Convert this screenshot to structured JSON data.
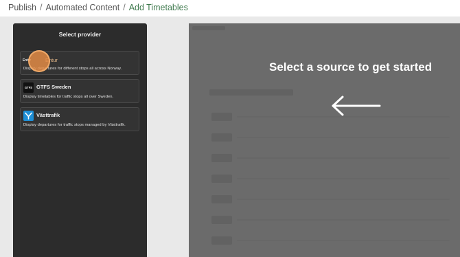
{
  "breadcrumb": {
    "items": [
      "Publish",
      "Automated Content"
    ],
    "separator": "/",
    "current": "Add Timetables"
  },
  "provider_panel": {
    "title": "Select provider",
    "providers": [
      {
        "name": "Entur",
        "logo_text": "Entur",
        "icon": "entur-logo-icon",
        "description": "Display departures for different stops all across Norway."
      },
      {
        "name": "GTFS Sweden",
        "logo_text": "GTFS",
        "icon": "trafiklab-logo-icon",
        "description": "Display timetables for traffic stops all over Sweden."
      },
      {
        "name": "Västtrafik",
        "icon": "vasttrafik-logo-icon",
        "description": "Display departures for traffic stops managed by Västtrafik."
      }
    ]
  },
  "preview": {
    "message": "Select a source to get started",
    "arrow_icon": "arrow-left-icon"
  },
  "colors": {
    "breadcrumb_current": "#3f7a4e",
    "panel_bg": "#2c2c2c",
    "preview_bg": "#6b6b6b",
    "highlight": "#e88e46",
    "vasttrafik_brand": "#1e8fd6"
  }
}
